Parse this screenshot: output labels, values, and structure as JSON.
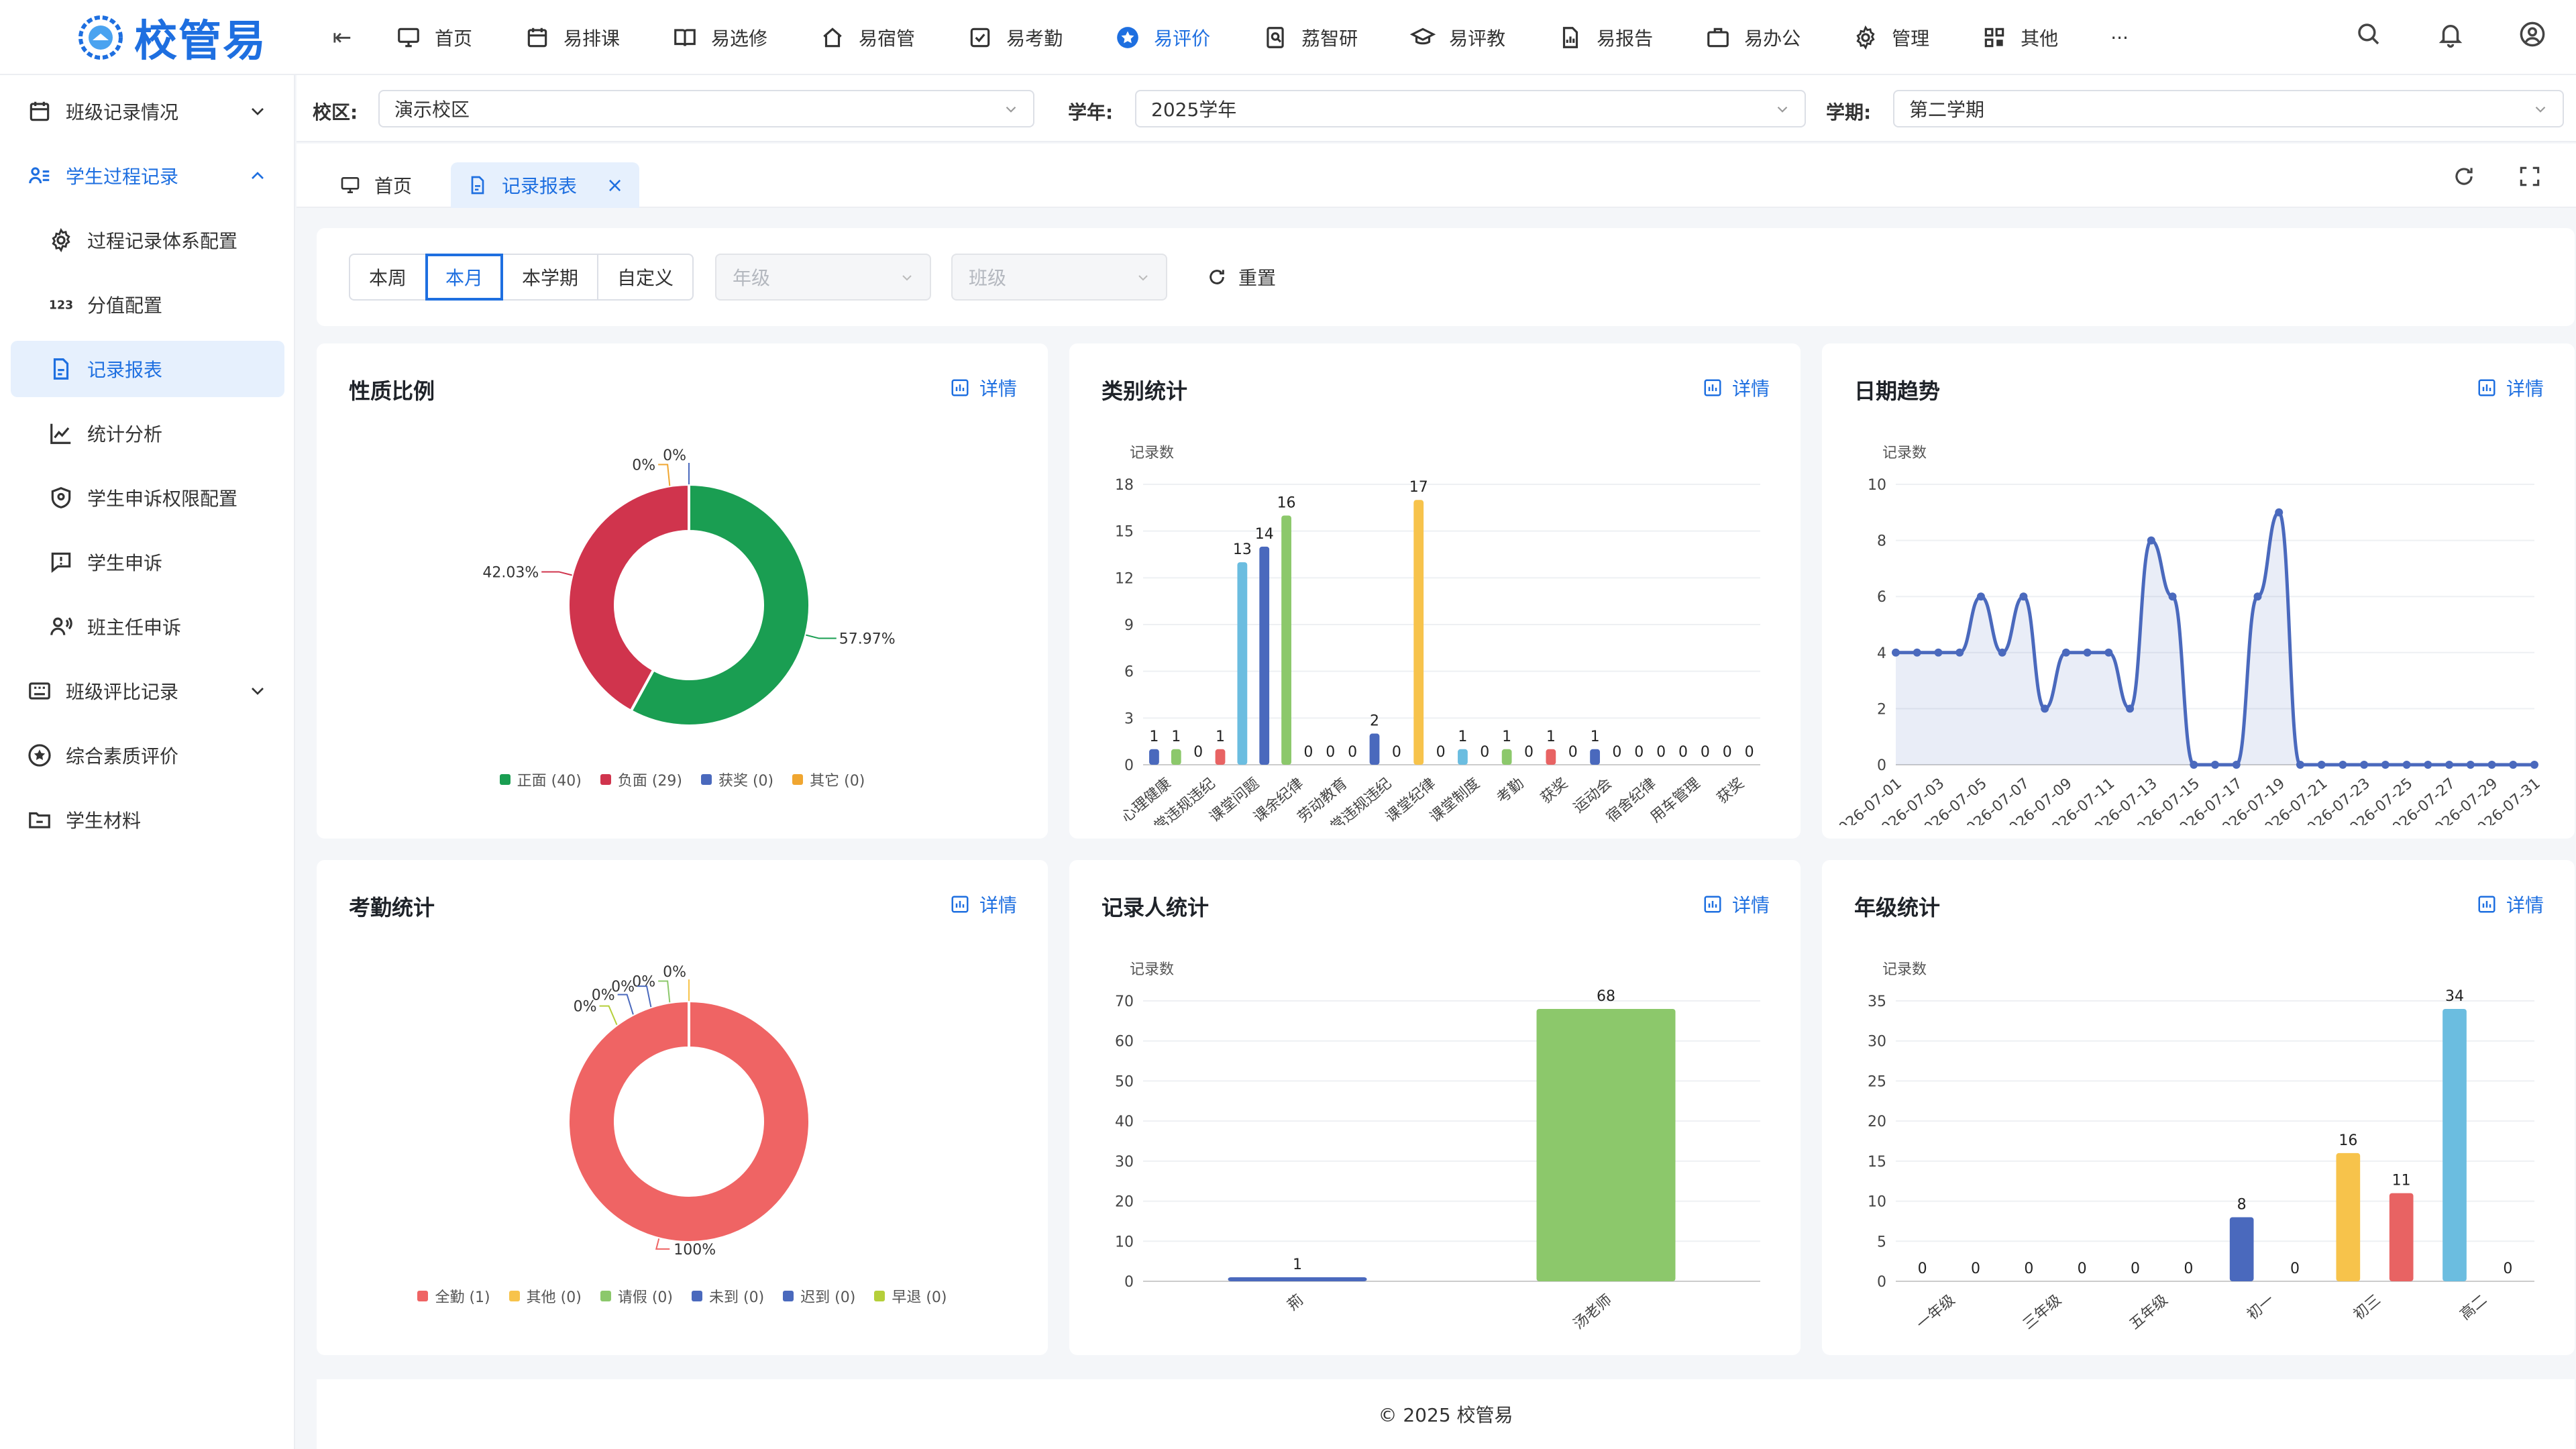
{
  "app": {
    "name": "校管易"
  },
  "nav": [
    {
      "label": "首页",
      "icon": "monitor-icon"
    },
    {
      "label": "易排课",
      "icon": "calendar-icon"
    },
    {
      "label": "易选修",
      "icon": "book-icon"
    },
    {
      "label": "易宿管",
      "icon": "house-icon"
    },
    {
      "label": "易考勤",
      "icon": "checkbox-icon"
    },
    {
      "label": "易评价",
      "icon": "star-icon",
      "active": true
    },
    {
      "label": "荔智研",
      "icon": "research-icon"
    },
    {
      "label": "易评教",
      "icon": "graduation-icon"
    },
    {
      "label": "易报告",
      "icon": "report-icon"
    },
    {
      "label": "易办公",
      "icon": "briefcase-icon"
    },
    {
      "label": "管理",
      "icon": "gear-icon"
    },
    {
      "label": "其他",
      "icon": "grid-icon"
    },
    {
      "label": "···",
      "icon": "more-icon"
    }
  ],
  "sidebar": {
    "items": [
      {
        "label": "班级记录情况",
        "level": 1,
        "chevron": "down",
        "icon": "calendar-icon"
      },
      {
        "label": "学生过程记录",
        "level": 1,
        "chevron": "up",
        "icon": "user-list-icon",
        "open": true
      },
      {
        "label": "过程记录体系配置",
        "level": 2,
        "icon": "gear-icon"
      },
      {
        "label": "分值配置",
        "level": 2,
        "icon": "123-icon"
      },
      {
        "label": "记录报表",
        "level": 2,
        "icon": "document-icon",
        "selected": true
      },
      {
        "label": "统计分析",
        "level": 2,
        "icon": "line-chart-icon"
      },
      {
        "label": "学生申诉权限配置",
        "level": 2,
        "icon": "shield-icon"
      },
      {
        "label": "学生申诉",
        "level": 2,
        "icon": "message-alert-icon"
      },
      {
        "label": "班主任申诉",
        "level": 2,
        "icon": "user-voice-icon"
      },
      {
        "label": "班级评比记录",
        "level": 1,
        "chevron": "down",
        "icon": "keyboard-icon"
      },
      {
        "label": "综合素质评价",
        "level": 1,
        "icon": "star-circle-icon"
      },
      {
        "label": "学生材料",
        "level": 1,
        "icon": "folder-icon"
      }
    ]
  },
  "filters": {
    "campus_label": "校区:",
    "campus_value": "演示校区",
    "year_label": "学年:",
    "year_value": "2025学年",
    "term_label": "学期:",
    "term_value": "第二学期"
  },
  "tabs": [
    {
      "label": "首页"
    },
    {
      "label": "记录报表",
      "active": true,
      "close": "×"
    }
  ],
  "controls": {
    "ranges": [
      "本周",
      "本月",
      "本学期",
      "自定义"
    ],
    "active_range": 1,
    "grade_placeholder": "年级",
    "class_placeholder": "班级",
    "reset_label": "重置"
  },
  "detail_label": "详情",
  "footer": "© 2025 校管易",
  "chart_data": [
    {
      "title": "性质比例",
      "type": "pie",
      "labels": [
        "正面",
        "负面",
        "获奖",
        "其它"
      ],
      "values": [
        40,
        29,
        0,
        0
      ],
      "percent_labels": [
        "57.97%",
        "42.03%",
        "0%",
        "0%"
      ],
      "legend": [
        "正面 (40)",
        "负面 (29)",
        "获奖 (0)",
        "其它 (0)"
      ],
      "colors": [
        "#1a9e52",
        "#d0344d",
        "#4a69bd",
        "#f0a630"
      ]
    },
    {
      "title": "类别统计",
      "type": "bar",
      "ylabel": "记录数",
      "ylim": [
        0,
        18
      ],
      "yticks": [
        0,
        3,
        6,
        9,
        12,
        15,
        18
      ],
      "categories": [
        "心理健康",
        "日常违规违纪",
        "课堂问题",
        "课余纪律",
        "劳动教育",
        "日常违规违纪",
        "课堂纪律",
        "课堂制度",
        "考勤",
        "获奖",
        "运动会",
        "宿舍纪律",
        "用车管理",
        "获奖"
      ],
      "values": [
        1,
        1,
        0,
        1,
        13,
        14,
        16,
        0,
        0,
        0,
        2,
        0,
        17,
        0,
        1,
        0,
        1,
        0,
        1,
        0,
        1,
        0,
        0,
        0,
        0,
        0,
        0,
        0
      ],
      "colors": [
        "#4a69bd",
        "#8cc86b",
        "#8cc86b",
        "#e86363",
        "#6bbde0",
        "#4a69bd",
        "#8cc86b",
        "#8cc86b",
        "#8cc86b",
        "#8cc86b",
        "#4a69bd",
        "#4a69bd",
        "#f7c34b",
        "#f7c34b",
        "#6bbde0",
        "#6bbde0",
        "#8cc86b",
        "#8cc86b",
        "#e86363",
        "#e86363",
        "#4a69bd",
        "#4a69bd",
        "#4a69bd",
        "#4a69bd",
        "#4a69bd",
        "#4a69bd",
        "#4a69bd",
        "#4a69bd"
      ]
    },
    {
      "title": "日期趋势",
      "type": "line",
      "ylabel": "记录数",
      "ylim": [
        0,
        10
      ],
      "yticks": [
        0,
        2,
        4,
        6,
        8,
        10
      ],
      "x": [
        "2026-07-01",
        "2026-07-02",
        "2026-07-03",
        "2026-07-04",
        "2026-07-05",
        "2026-07-06",
        "2026-07-07",
        "2026-07-08",
        "2026-07-09",
        "2026-07-10",
        "2026-07-11",
        "2026-07-12",
        "2026-07-13",
        "2026-07-14",
        "2026-07-15",
        "2026-07-16",
        "2026-07-17",
        "2026-07-18",
        "2026-07-19",
        "2026-07-20",
        "2026-07-21",
        "2026-07-22",
        "2026-07-23",
        "2026-07-24",
        "2026-07-25",
        "2026-07-26",
        "2026-07-27",
        "2026-07-28",
        "2026-07-29",
        "2026-07-30",
        "2026-07-31"
      ],
      "values": [
        4,
        4,
        4,
        4,
        6,
        4,
        6,
        2,
        4,
        4,
        4,
        2,
        8,
        6,
        0,
        0,
        0,
        6,
        9,
        0,
        0,
        0,
        0,
        0,
        0,
        0,
        0,
        0,
        0,
        0,
        0
      ]
    },
    {
      "title": "考勤统计",
      "type": "pie",
      "labels": [
        "全勤",
        "其他",
        "请假",
        "未到",
        "迟到",
        "早退"
      ],
      "values": [
        1,
        0,
        0,
        0,
        0,
        0
      ],
      "percent_labels": [
        "100%",
        "0%",
        "0%",
        "0%",
        "0%",
        "0%"
      ],
      "legend": [
        "全勤 (1)",
        "其他 (0)",
        "请假 (0)",
        "未到 (0)",
        "迟到 (0)",
        "早退 (0)"
      ],
      "colors": [
        "#ef6464",
        "#f7c34b",
        "#8cc86b",
        "#4a69bd",
        "#4a69bd",
        "#b5cf3a"
      ]
    },
    {
      "title": "记录人统计",
      "type": "bar",
      "ylabel": "记录数",
      "ylim": [
        0,
        70
      ],
      "yticks": [
        0,
        10,
        20,
        30,
        40,
        50,
        60,
        70
      ],
      "categories": [
        "荊",
        "汤老师"
      ],
      "values": [
        1,
        68
      ],
      "colors": [
        "#4a69bd",
        "#8cc86b"
      ]
    },
    {
      "title": "年级统计",
      "type": "bar",
      "ylabel": "记录数",
      "ylim": [
        0,
        35
      ],
      "yticks": [
        0,
        5,
        10,
        15,
        20,
        25,
        30,
        35
      ],
      "categories": [
        "一年级",
        "三年级",
        "五年级",
        "初一",
        "初三",
        "高二"
      ],
      "values": [
        0,
        0,
        0,
        0,
        0,
        0,
        8,
        0,
        16,
        11,
        34,
        0
      ],
      "colors": [
        "#4a69bd",
        "#4a69bd",
        "#4a69bd",
        "#4a69bd",
        "#4a69bd",
        "#4a69bd",
        "#4a69bd",
        "#4a69bd",
        "#f7c34b",
        "#e86363",
        "#6bbde0",
        "#4a69bd"
      ]
    }
  ]
}
